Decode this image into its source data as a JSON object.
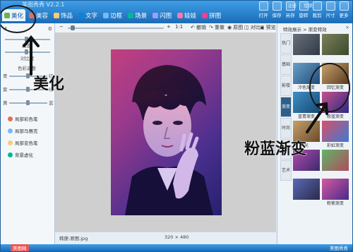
{
  "app": {
    "title": "美图秀秀 V2.2.1"
  },
  "account": {
    "login": "登录",
    "register": "注册"
  },
  "tabs": [
    {
      "label": "美化",
      "color": "#6ab04c"
    },
    {
      "label": "美容",
      "color": "#e17055"
    },
    {
      "label": "饰品",
      "color": "#fdcb6e"
    },
    {
      "label": "文字",
      "color": "#0984e3"
    },
    {
      "label": "边框",
      "color": "#74b9ff"
    },
    {
      "label": "场景",
      "color": "#00b894"
    },
    {
      "label": "闪图",
      "color": "#a29bfe"
    },
    {
      "label": "娃娃",
      "color": "#fd79a8"
    },
    {
      "label": "拼图",
      "color": "#e84393"
    }
  ],
  "right_tools": [
    {
      "label": "打开",
      "icon": "folder-icon"
    },
    {
      "label": "保存",
      "icon": "save-icon"
    },
    {
      "label": "另存",
      "icon": "save-as-icon"
    },
    {
      "label": "旋转",
      "icon": "rotate-icon"
    },
    {
      "label": "裁剪",
      "icon": "crop-icon"
    },
    {
      "label": "尺寸",
      "icon": "resize-icon"
    },
    {
      "label": "更多",
      "icon": "more-icon"
    }
  ],
  "left_panel": {
    "brightness_label": "亮度",
    "contrast_label": "对比度",
    "color_label": "色彩调整",
    "slider_labels": [
      "青",
      "红",
      "紫",
      "绿",
      "黄",
      "蓝"
    ],
    "effects": [
      {
        "label": "局部彩色笔",
        "color": "#e17055"
      },
      {
        "label": "局部马赛克",
        "color": "#74b9ff"
      },
      {
        "label": "局部变色笔",
        "color": "#fdcb6e"
      },
      {
        "label": "背景虚化",
        "color": "#00b894"
      }
    ]
  },
  "canvas_toolbar": {
    "zoom_minus": "−",
    "zoom_plus": "+",
    "ratio": "1:1",
    "undo": "撤销",
    "redo": "重做",
    "original": "原图",
    "compare": "对比",
    "preview": "预览"
  },
  "status": {
    "file_label": "韩庚:原图.jpg",
    "size": "320 × 480"
  },
  "right_panel": {
    "header": "特效展示 > 渐变特效",
    "close": "×",
    "categories": [
      "热门",
      "基础",
      "影楼",
      "渐变",
      "时尚",
      "节日",
      "艺术"
    ],
    "active_category": 3,
    "thumbs": [
      {
        "caption": "",
        "color1": "#6a6f7a",
        "color2": "#2f3a46"
      },
      {
        "caption": "",
        "color1": "#7b7f5a",
        "color2": "#3b4a2c"
      },
      {
        "caption": "冷色渐变",
        "color1": "#6ba1c7",
        "color2": "#1f4b7a"
      },
      {
        "caption": "回忆渐变",
        "color1": "#c9a56b",
        "color2": "#5a3a20"
      },
      {
        "caption": "蓝青渐变",
        "color1": "#3f8ec7",
        "color2": "#16496f"
      },
      {
        "caption": "粉蓝渐变",
        "color1": "#c7508b",
        "color2": "#2a2a85"
      },
      {
        "caption": "光",
        "color1": "#c4a16a",
        "color2": "#6a4a2a"
      },
      {
        "caption": "彩虹渐变",
        "color1": "#d94f6b",
        "color2": "#3e7ad1"
      },
      {
        "caption": "",
        "color1": "#b24bb0",
        "color2": "#3a2a6b"
      },
      {
        "caption": "",
        "color1": "#5fb56a",
        "color2": "#b24b5c"
      },
      {
        "caption": "",
        "color1": "#5a6ab8",
        "color2": "#2a2a4a"
      },
      {
        "caption": "粉紫渐变",
        "color1": "#d45aa0",
        "color2": "#4a2a8a"
      }
    ]
  },
  "bottom": {
    "left": "美图网",
    "right": "美图秀秀"
  },
  "annotations": {
    "beautify": "美化",
    "pink_blue": "粉蓝渐变"
  }
}
